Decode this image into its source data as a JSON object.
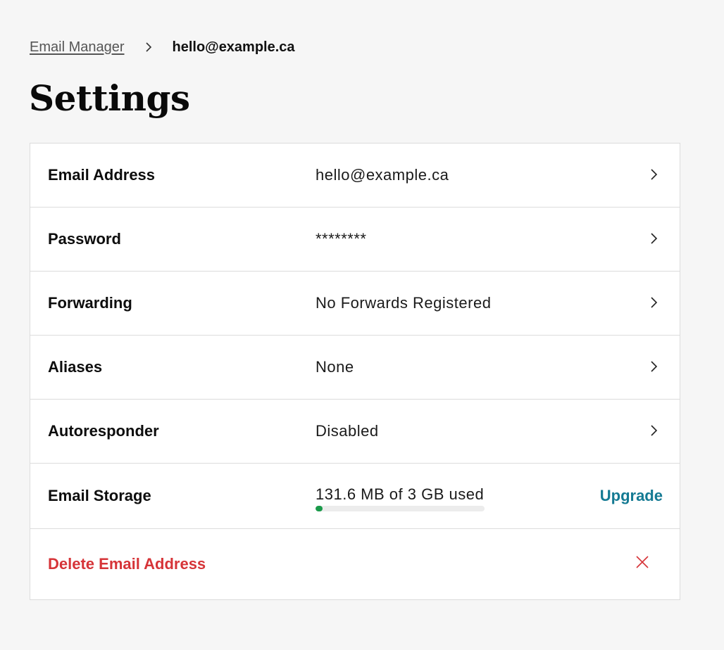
{
  "breadcrumb": {
    "parent": "Email Manager",
    "current": "hello@example.ca"
  },
  "page": {
    "title": "Settings"
  },
  "settings": {
    "rows": [
      {
        "label": "Email Address",
        "value": "hello@example.ca"
      },
      {
        "label": "Password",
        "value": "********"
      },
      {
        "label": "Forwarding",
        "value": "No Forwards Registered"
      },
      {
        "label": "Aliases",
        "value": "None"
      },
      {
        "label": "Autoresponder",
        "value": "Disabled"
      }
    ],
    "storage": {
      "label": "Email Storage",
      "usage_text": "131.6 MB of 3 GB used",
      "used_mb": 131.6,
      "total_gb": 3,
      "fraction_used": 0.0428,
      "action": "Upgrade"
    },
    "delete": {
      "label": "Delete Email Address"
    }
  },
  "icons": {
    "breadcrumb_separator": "chevron-right-icon",
    "row_chevron": "chevron-right-icon",
    "delete": "close-icon"
  },
  "colors": {
    "page_background": "#f6f6f6",
    "card_background": "#ffffff",
    "border": "#dcdcdc",
    "danger": "#d63438",
    "link": "#147a93",
    "progress_fill": "#1a9a4a",
    "progress_track": "#ececec"
  }
}
